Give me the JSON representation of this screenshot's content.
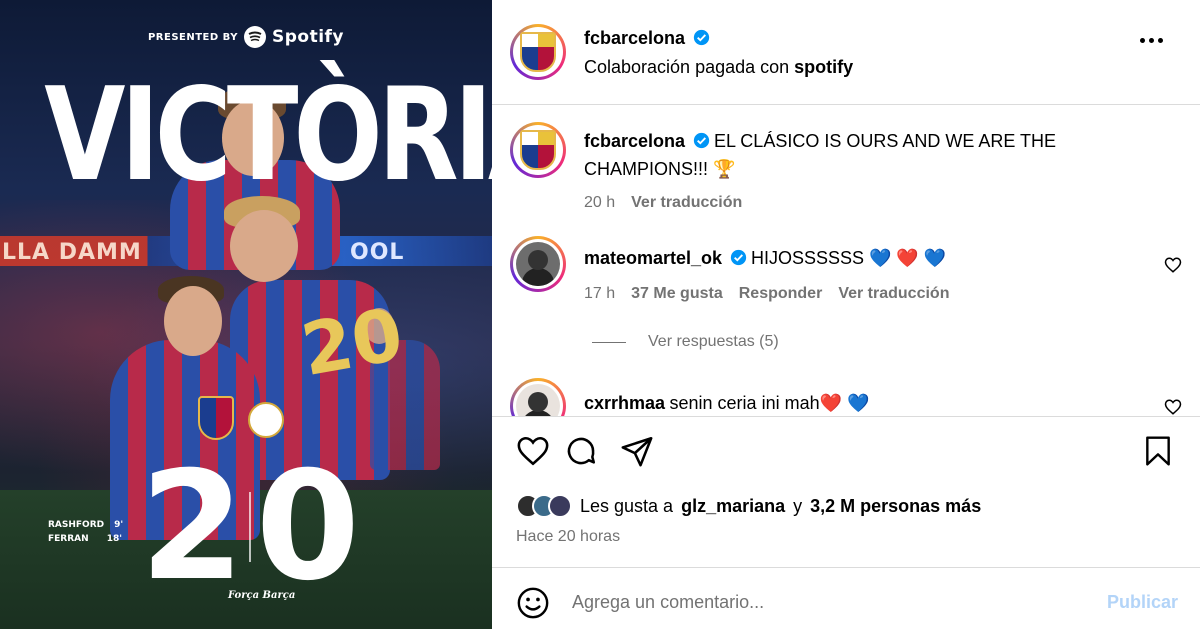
{
  "image": {
    "presented_by": "PRESENTED BY",
    "sponsor": "Spotify",
    "headline": "VICTÒRIA",
    "banner_left": "LLA DAMM",
    "banner_right": "OOL",
    "jersey_number": "20",
    "score_home": "2",
    "score_away": "0",
    "scorers": [
      {
        "name": "RASHFORD",
        "minute": "9'"
      },
      {
        "name": "FERRAN",
        "minute": "18'"
      }
    ],
    "signature": "Força Barça"
  },
  "header": {
    "username": "fcbarcelona",
    "subtitle_prefix": "Colaboración pagada con",
    "subtitle_brand": "spotify",
    "more_icon": "more-horizontal-icon"
  },
  "caption": {
    "username": "fcbarcelona",
    "text_line1": "EL CLÁSICO IS OURS AND WE ARE THE",
    "text_line2": "CHAMPIONS!!! 🏆",
    "time": "20 h",
    "translate": "Ver traducción"
  },
  "comments": [
    {
      "username": "mateomartel_ok",
      "text": "HIJOSSSSSS 💙 ❤️ 💙",
      "time": "17 h",
      "likes": "37 Me gusta",
      "reply": "Responder",
      "translate": "Ver traducción",
      "view_replies": "Ver respuestas (5)"
    },
    {
      "username": "cxrrhmaa",
      "text": "senin ceria ini mah❤️ 💙"
    }
  ],
  "actions": {
    "like_icon": "heart-icon",
    "comment_icon": "comment-icon",
    "share_icon": "send-icon",
    "save_icon": "bookmark-icon"
  },
  "likes": {
    "prefix": "Les gusta a",
    "user": "glz_mariana",
    "middle": "y",
    "count": "3,2 M personas más"
  },
  "posted": "Hace 20 horas",
  "composer": {
    "emoji_icon": "emoji-icon",
    "placeholder": "Agrega un comentario...",
    "publish": "Publicar"
  },
  "colors": {
    "verified": "#0095f6",
    "muted_text": "#737373",
    "publish_disabled": "#b3d4f8",
    "heart_red": "#e0245e",
    "heart_blue": "#1f5fd1"
  }
}
